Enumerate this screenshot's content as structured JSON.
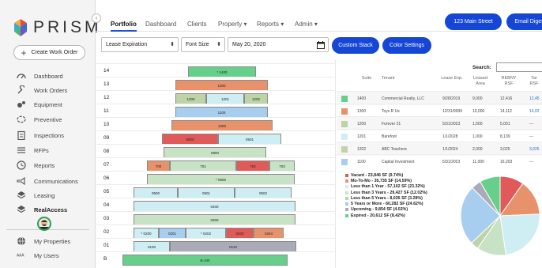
{
  "app": {
    "logo_text": "PRISM"
  },
  "sidebar": {
    "create_button": "Create Work Order",
    "items": [
      {
        "label": "Dashboard",
        "icon": "speedometer-icon"
      },
      {
        "label": "Work Orders",
        "icon": "wrench-icon"
      },
      {
        "label": "Equipment",
        "icon": "gears-icon"
      },
      {
        "label": "Preventive",
        "icon": "cycle-icon"
      },
      {
        "label": "Inspections",
        "icon": "clipboard-icon"
      },
      {
        "label": "RFPs",
        "icon": "list-icon"
      },
      {
        "label": "Reports",
        "icon": "clock-icon"
      },
      {
        "label": "Communications",
        "icon": "megaphone-icon"
      },
      {
        "label": "Leasing",
        "icon": "layers-icon"
      },
      {
        "label": "RealAccess",
        "icon": "layers-icon"
      },
      {
        "label": "My Properties",
        "icon": "globe-icon"
      },
      {
        "label": "My Users",
        "icon": "users-icon"
      }
    ]
  },
  "header": {
    "tabs": [
      {
        "label": "Portfolio"
      },
      {
        "label": "Dashboard"
      },
      {
        "label": "Clients"
      },
      {
        "label": "Property ▾"
      },
      {
        "label": "Reports ▾"
      },
      {
        "label": "Admin ▾"
      }
    ],
    "address_button": "123 Main Street",
    "email_button": "Email Digest"
  },
  "toolbar": {
    "lease_select": "Lease Expiration",
    "font_select": "Font Size",
    "date_value": "May 20, 2020",
    "custom_stack_button": "Custom Stack",
    "color_settings_button": "Color Settings"
  },
  "colors": {
    "vacant": "#e05a5a",
    "mtm": "#e8926c",
    "lt1": "#cfeef3",
    "lt3": "#c7e2c4",
    "lt5": "#bdd3a8",
    "five_plus": "#a7cdef",
    "upcoming": "#a9abb7",
    "expired": "#66d08a"
  },
  "stack": {
    "floors": [
      {
        "label": "14",
        "suites": [
          {
            "name": "* 1400",
            "color": "#66d08a"
          }
        ]
      },
      {
        "label": "13",
        "suites": [
          {
            "name": "1300",
            "color": "#e8926c"
          }
        ]
      },
      {
        "label": "12",
        "suites": [
          {
            "name": "1200",
            "color": "#bdd3a8"
          },
          {
            "name": "1201",
            "color": "#cfeef3"
          },
          {
            "name": "1202",
            "color": "#bdd3a8"
          }
        ]
      },
      {
        "label": "11",
        "suites": [
          {
            "name": "1100",
            "color": "#a7cdef"
          }
        ]
      },
      {
        "label": "10",
        "suites": [
          {
            "name": "1000",
            "color": "#e8926c"
          }
        ]
      },
      {
        "label": "09",
        "suites": [
          {
            "name": "0900",
            "color": "#e05a5a"
          },
          {
            "name": "0901",
            "color": "#cfeef3"
          }
        ]
      },
      {
        "label": "08",
        "suites": [
          {
            "name": "0800",
            "color": "#c7e2c4"
          }
        ]
      },
      {
        "label": "07",
        "suites": [
          {
            "name": "700",
            "color": "#e8926c"
          },
          {
            "name": "701",
            "color": "#c7e2c4"
          },
          {
            "name": "702",
            "color": "#e05a5a"
          },
          {
            "name": "703",
            "color": "#c7e2c4"
          }
        ]
      },
      {
        "label": "06",
        "suites": [
          {
            "name": "* 0600",
            "color": "#c7e2c4"
          }
        ]
      },
      {
        "label": "05",
        "suites": [
          {
            "name": "0500",
            "color": "#cfeef3"
          },
          {
            "name": "0501",
            "color": "#cfeef3"
          },
          {
            "name": "0502",
            "color": "#cfeef3"
          }
        ]
      },
      {
        "label": "04",
        "suites": [
          {
            "name": "0400",
            "color": "#cfeef3"
          }
        ]
      },
      {
        "label": "03",
        "suites": [
          {
            "name": "0300",
            "color": "#c7e2c4"
          }
        ]
      },
      {
        "label": "02",
        "suites": [
          {
            "name": "* 0200",
            "color": "#cfeef3"
          },
          {
            "name": "0201",
            "color": "#a7cdef"
          },
          {
            "name": "* 0202",
            "color": "#cfeef3"
          },
          {
            "name": "0203",
            "color": "#e05a5a"
          },
          {
            "name": "0204",
            "color": "#e8926c"
          }
        ]
      },
      {
        "label": "01",
        "suites": [
          {
            "name": "0100",
            "color": "#cfeef3"
          },
          {
            "name": "0110",
            "color": "#a9abb7"
          }
        ]
      },
      {
        "label": "B",
        "suites": [
          {
            "name": "B-100",
            "color": "#66d08a"
          }
        ]
      }
    ]
  },
  "table": {
    "search_label": "Search:",
    "headers": [
      "Suite",
      "Tenant",
      "Lease Exp.",
      "Leased Area",
      "REBNY RSF",
      "Tar RSF"
    ],
    "rows": [
      {
        "suite": "1400",
        "tenant": "Commercial Realty, LLC",
        "exp": "9/28/2019",
        "area": "9,000",
        "rebny": "12,416",
        "tar": "12,45",
        "color": "#66d08a"
      },
      {
        "suite": "1300",
        "tenant": "Toys R Us",
        "exp": "12/31/9999",
        "area": "10,000",
        "rebny": "14,112",
        "tar": "14,02",
        "color": "#e8926c"
      },
      {
        "suite": "1200",
        "tenant": "Forever 21",
        "exp": "5/31/2023",
        "area": "1,000",
        "rebny": "5,001",
        "tar": "---",
        "color": "#bdd3a8"
      },
      {
        "suite": "1201",
        "tenant": "Barefoot",
        "exp": "1/1/2028",
        "area": "1,000",
        "rebny": "8,139",
        "tar": "---",
        "color": "#cfeef3"
      },
      {
        "suite": "1202",
        "tenant": "ABC Teachers",
        "exp": "1/1/2024",
        "area": "2,000",
        "rebny": "3,025",
        "tar": "3,025",
        "color": "#bdd3a8"
      },
      {
        "suite": "1100",
        "tenant": "Capital Investment",
        "exp": "5/31/2023",
        "area": "11,000",
        "rebny": "16,203",
        "tar": "---",
        "color": "#a7cdef"
      }
    ]
  },
  "legend": [
    {
      "text": "Vacant - 23,846 SF (9.74%)",
      "color": "#e05a5a"
    },
    {
      "text": "Mo-To-Mo - 35,735 SF (14.59%)",
      "color": "#e8926c"
    },
    {
      "text": "Less than 1 Year - 57,102 SF (23.32%)",
      "color": "#cfeef3"
    },
    {
      "text": "Less than 3 Years - 29,427 SF (12.02%)",
      "color": "#c7e2c4"
    },
    {
      "text": "Less than 5 Years - 8,026 SF (3.28%)",
      "color": "#bdd3a8"
    },
    {
      "text": "5 Years or More - 60,282 SF (24.62%)",
      "color": "#a7cdef"
    },
    {
      "text": "Upcoming - 9,854 SF (4.02%)",
      "color": "#a9abb7"
    },
    {
      "text": "Expired - 20,612 SF (8.42%)",
      "color": "#66d08a"
    }
  ],
  "pie_data": [
    9.74,
    14.59,
    23.32,
    12.02,
    3.28,
    24.62,
    4.02,
    8.42
  ]
}
